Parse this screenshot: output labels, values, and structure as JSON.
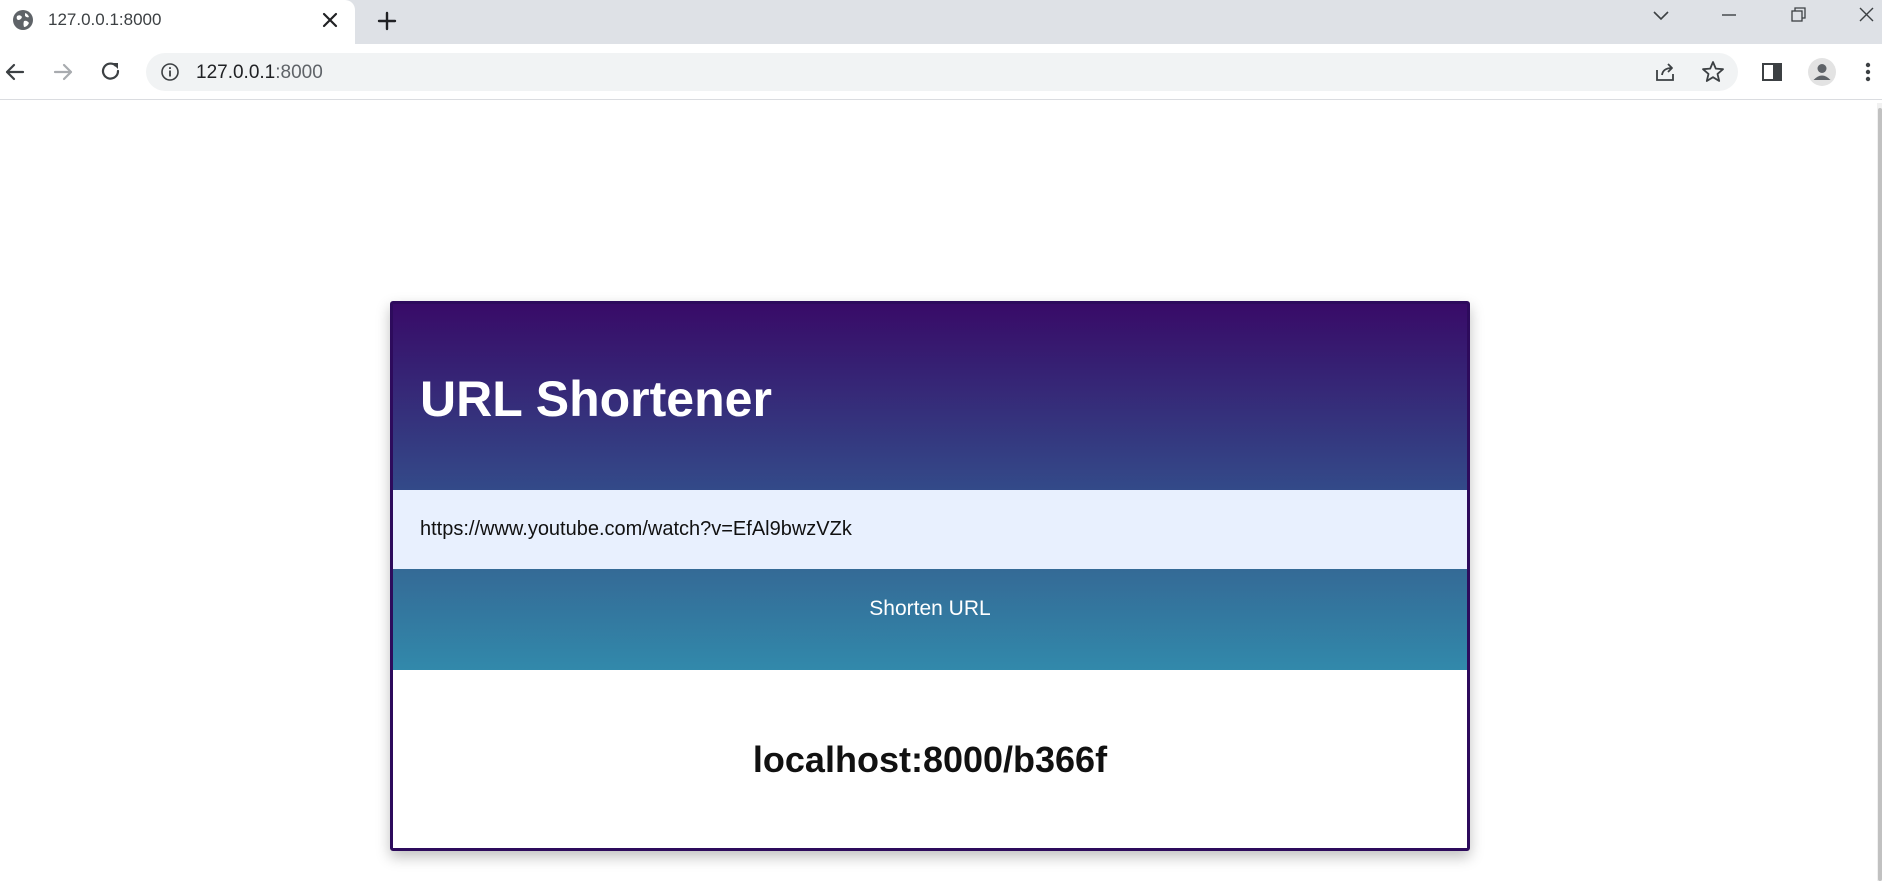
{
  "browser": {
    "tab": {
      "title": "127.0.0.1:8000",
      "favicon": "globe-icon"
    },
    "address_bar": {
      "host": "127.0.0.1",
      "port": ":8000"
    },
    "icons": {
      "back": "back-arrow-icon",
      "forward": "forward-arrow-icon",
      "reload": "reload-icon",
      "info": "info-icon",
      "share": "share-icon",
      "bookmark": "star-icon",
      "side_panel": "side-panel-icon",
      "profile": "profile-icon",
      "menu": "kebab-menu-icon",
      "new_tab": "plus-icon",
      "tab_search": "chevron-down-icon",
      "minimize": "minimize-icon",
      "restore": "restore-icon",
      "close": "close-icon"
    }
  },
  "app": {
    "title": "URL Shortener",
    "input": {
      "value": "https://www.youtube.com/watch?v=EfAl9bwzVZk"
    },
    "button_label": "Shorten URL",
    "result": "localhost:8000/b366f"
  },
  "colors": {
    "header_top": "#380b68",
    "header_bottom": "#334a89",
    "input_bg": "#e8f0fe",
    "button_top": "#346a96",
    "button_bottom": "#3289ab",
    "card_border": "#2d0b5c"
  }
}
